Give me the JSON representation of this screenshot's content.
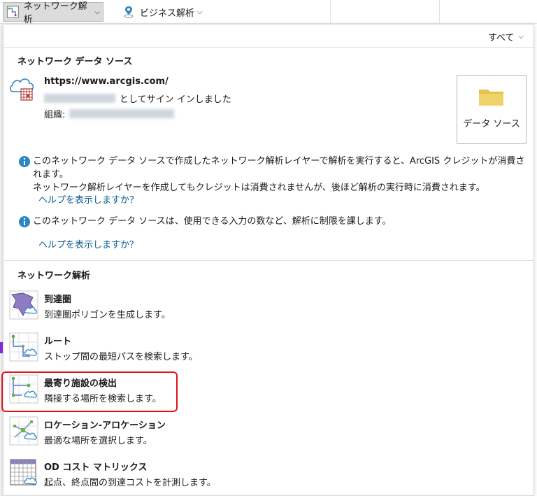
{
  "ribbon": {
    "network_analysis_label": "ネットワーク解析",
    "business_analysis_label": "ビジネス解析"
  },
  "panel": {
    "filter_label": "すべて",
    "data_source_section": {
      "title": "ネットワーク データ ソース",
      "url": "https://www.arcgis.com/",
      "signed_in_suffix": "としてサイン インしました",
      "org_label": "組織:",
      "data_source_button_label": "データ ソース",
      "info_1_line_1": "このネットワーク データ ソースで作成したネットワーク解析レイヤーで解析を実行すると、ArcGIS クレジットが消費されます。",
      "info_1_line_2": "ネットワーク解析レイヤーを作成してもクレジットは消費されませんが、後ほど解析の実行時に消費されます。",
      "help_link_1": "ヘルプを表示しますか？",
      "info_2": "このネットワーク データ ソースは、使用できる入力の数など、解析に制限を課します。",
      "help_link_2": "ヘルプを表示しますか？"
    },
    "analysis_section": {
      "title": "ネットワーク解析",
      "tools": [
        {
          "name": "到達圏",
          "desc": "到達圏ポリゴンを生成します。",
          "icon": "service-area-icon"
        },
        {
          "name": "ルート",
          "desc": "ストップ間の最短パスを検索します。",
          "icon": "route-icon"
        },
        {
          "name": "最寄り施設の検出",
          "desc": "隣接する場所を検索します。",
          "icon": "closest-facility-icon"
        },
        {
          "name": "ロケーション-アロケーション",
          "desc": "最適な場所を選択します。",
          "icon": "location-allocation-icon"
        },
        {
          "name": "OD コスト マトリックス",
          "desc": "起点、終点間の到達コストを計測します。",
          "icon": "od-cost-matrix-icon"
        }
      ]
    }
  },
  "colors": {
    "link": "#0b5c8e",
    "info_icon": "#2e86c1",
    "highlight": "#e0141e",
    "folder": "#e6c24a"
  }
}
